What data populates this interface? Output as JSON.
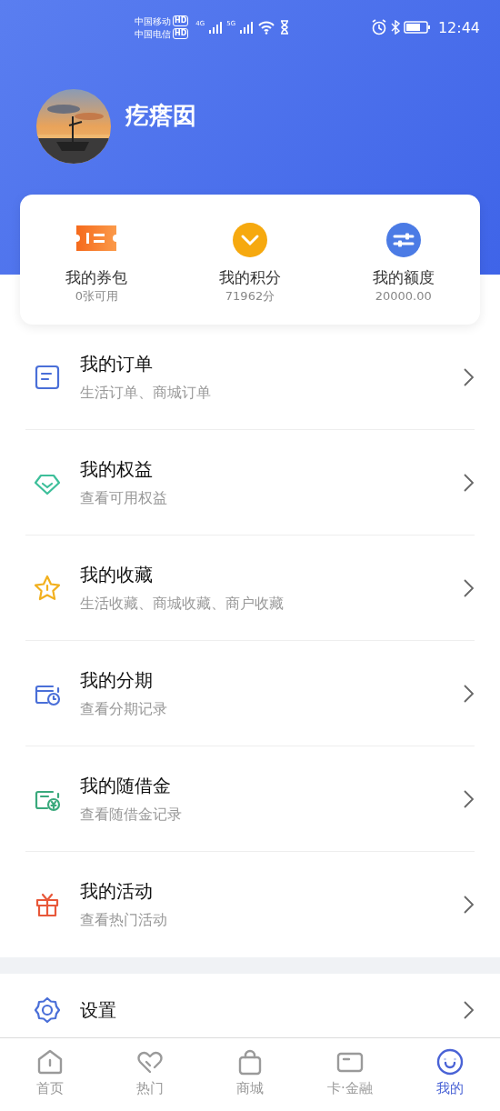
{
  "status_bar": {
    "carriers": [
      {
        "name": "中国移动",
        "badge": "HD"
      },
      {
        "name": "中国电信",
        "badge": "HD"
      }
    ],
    "signals": [
      "4G",
      "5G"
    ],
    "time": "12:44"
  },
  "profile": {
    "name": "疙瘩囡"
  },
  "quick_stats": [
    {
      "kind": "coupon",
      "label": "我的券包",
      "value": "0张可用"
    },
    {
      "kind": "points",
      "label": "我的积分",
      "value": "71962分"
    },
    {
      "kind": "limit",
      "label": "我的额度",
      "value": "20000.00"
    }
  ],
  "menu": [
    {
      "kind": "order",
      "color": "#4a6fd8",
      "title": "我的订单",
      "subtitle": "生活订单、商城订单"
    },
    {
      "kind": "gem",
      "color": "#3dbf9a",
      "title": "我的权益",
      "subtitle": "查看可用权益"
    },
    {
      "kind": "star",
      "color": "#f2b01e",
      "title": "我的收藏",
      "subtitle": "生活收藏、商城收藏、商户收藏"
    },
    {
      "kind": "installment",
      "color": "#4a6fd8",
      "title": "我的分期",
      "subtitle": "查看分期记录"
    },
    {
      "kind": "cash",
      "color": "#3aa97c",
      "title": "我的随借金",
      "subtitle": "查看随借金记录"
    },
    {
      "kind": "gift",
      "color": "#e8583a",
      "title": "我的活动",
      "subtitle": "查看热门活动"
    }
  ],
  "settings": {
    "kind": "gear",
    "color": "#4a6fd8",
    "title": "设置"
  },
  "tab_bar": [
    {
      "kind": "home",
      "label": "首页",
      "selected": false
    },
    {
      "kind": "heart",
      "label": "热门",
      "selected": false
    },
    {
      "kind": "bag",
      "label": "商城",
      "selected": false
    },
    {
      "kind": "card",
      "label": "卡·金融",
      "selected": false
    },
    {
      "kind": "smile",
      "label": "我的",
      "selected": true
    }
  ]
}
